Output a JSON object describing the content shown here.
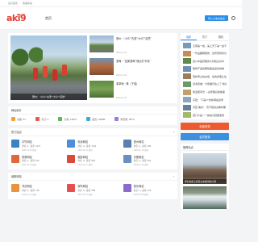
{
  "topbar": {
    "link1": "设为首页",
    "link2": "收藏本站"
  },
  "logo": {
    "main": "aki9",
    "sub": "网址之家"
  },
  "nav": {
    "home": "首页"
  },
  "header": {
    "register": "带入小本全信息"
  },
  "hero": {
    "caption": "惠州：“小众”“古老”“大众”“自然”",
    "list": [
      {
        "title": "惠州：“小众”“古老”“大众”“自然”",
        "date": "2022-11-23"
      },
      {
        "title": "滨海：“至美滨海”“踩点打卡地”",
        "date": "2022-11-18"
      },
      {
        "title": "茅草地 · 美（下载）",
        "date": "2022-11-06"
      },
      {
        "title": "惠州：“小众”“古老”“大众”“自然”",
        "date": "2022-11-03"
      }
    ]
  },
  "stats": {
    "title": "网址统计",
    "items": [
      {
        "label": "总数: 51",
        "color": "#f0a23b"
      },
      {
        "label": "今日: 0",
        "color": "#e85a4f"
      },
      {
        "label": "分类: 11872",
        "color": "#5cb85c"
      },
      {
        "label": "会员: 24889",
        "color": "#4aa3df"
      },
      {
        "label": "浏览量: 9573",
        "color": "#9b7ad8"
      }
    ]
  },
  "popular": {
    "title": "热门站点",
    "items": [
      {
        "name": "青竹网站",
        "meta": "浏览: 0，投票: 1274",
        "date": "2022-11-23 更新",
        "color": "#3b82c4"
      },
      {
        "name": "电池网站",
        "meta": "浏览: 0，投票: 1011",
        "date": "2022-11-21 更新",
        "color": "#4a90d9"
      },
      {
        "name": "惠州网站",
        "meta": "浏览: 0，投票: 982",
        "date": "2022-11-19 更新",
        "color": "#5a7fb0"
      },
      {
        "name": "茶香网站",
        "meta": "浏览: 0，投票: 913",
        "date": "2022-11-18 更新",
        "color": "#e1673c"
      },
      {
        "name": "摄影网站",
        "meta": "浏览: 0，投票: 866",
        "date": "2022-11-17 更新",
        "color": "#d84a3a"
      },
      {
        "name": "手账网站",
        "meta": "浏览: 0，投票: 801",
        "date": "2022-11-15 更新",
        "color": "#6a8fc0"
      }
    ]
  },
  "recent": {
    "title": "最新网站",
    "items": [
      {
        "name": "书法网站",
        "meta": "浏览: 0，投票: 726",
        "date": "2022-11-12 更新",
        "color": "#e8933d"
      },
      {
        "name": "观鸟网站",
        "meta": "浏览: 0，投票: 688",
        "date": "2022-11-10 更新",
        "color": "#e54f4f"
      },
      {
        "name": "音乐网站",
        "meta": "浏览: 0，投票: 640",
        "date": "2022-11-08 更新",
        "color": "#8b6cc9"
      }
    ]
  },
  "sidebar": {
    "tabs": [
      "最新",
      "热门",
      "随机"
    ],
    "items": [
      "云南第一峰，第上天下第一最不好找",
      "一代岳麓朝阳所，世界奇特风光",
      "四川中医药服务大同和全共享",
      "数码产品的那些事是最好的物",
      "西岭雪山的白色，住的还能让住",
      "甘肃武威：大熊猫们住上了“新房”",
      "徐溢西风光 —古老黑白的故事",
      "东阳：“下来户”的新网站目录",
      "景区“美好”：景不知的点看时期",
      "西门户是一一些地方经典游观"
    ],
    "btn_submit": "免费收录",
    "btn_login": "会员登录",
    "featured_title": "推荐站点",
    "featured_caption": "梦幻在桥上欣赏山水美景的小店",
    "item_colors": [
      "#7a9bb8",
      "#c88a5a",
      "#5d8a4c",
      "#6f90b2",
      "#9a7c5e",
      "#6b9a6a",
      "#c2a06e",
      "#8aa6c1",
      "#6d7f93",
      "#a3b86c"
    ]
  }
}
